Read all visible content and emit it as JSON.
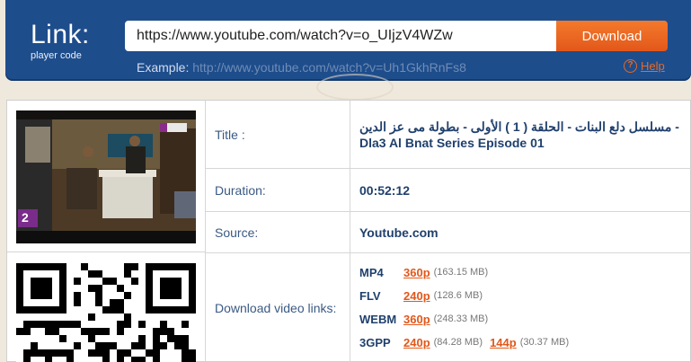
{
  "brand": {
    "title": "Link:",
    "subtitle": "player code"
  },
  "search": {
    "value": "https://www.youtube.com/watch?v=o_UIjzV4WZw",
    "button": "Download"
  },
  "example": {
    "label": "Example:",
    "url": "http://www.youtube.com/watch?v=Uh1GkhRnFs8"
  },
  "help": {
    "icon": "?",
    "label": "Help"
  },
  "video": {
    "title_label": "Title :",
    "title": "مسلسل دلع البنات - الحلقة ( 1 ) الأولى - بطولة مى عز الدين - Dla3 Al Bnat Series Episode 01",
    "duration_label": "Duration:",
    "duration": "00:52:12",
    "source_label": "Source:",
    "source": "Youtube.com",
    "links_label": "Download video links:",
    "channel_badge": "2",
    "links": [
      {
        "format": "MP4",
        "items": [
          {
            "quality": "360p",
            "size": "(163.15 MB)"
          }
        ]
      },
      {
        "format": "FLV",
        "items": [
          {
            "quality": "240p",
            "size": "(128.6 MB)"
          }
        ]
      },
      {
        "format": "WEBM",
        "items": [
          {
            "quality": "360p",
            "size": "(248.33 MB)"
          }
        ]
      },
      {
        "format": "3GPP",
        "items": [
          {
            "quality": "240p",
            "size": "(84.28 MB)"
          },
          {
            "quality": "144p",
            "size": "(30.37 MB)"
          }
        ]
      }
    ]
  },
  "colors": {
    "header": "#1e4d8c",
    "accent": "#e86a24",
    "label": "#3a5a84",
    "value": "#20406d"
  }
}
